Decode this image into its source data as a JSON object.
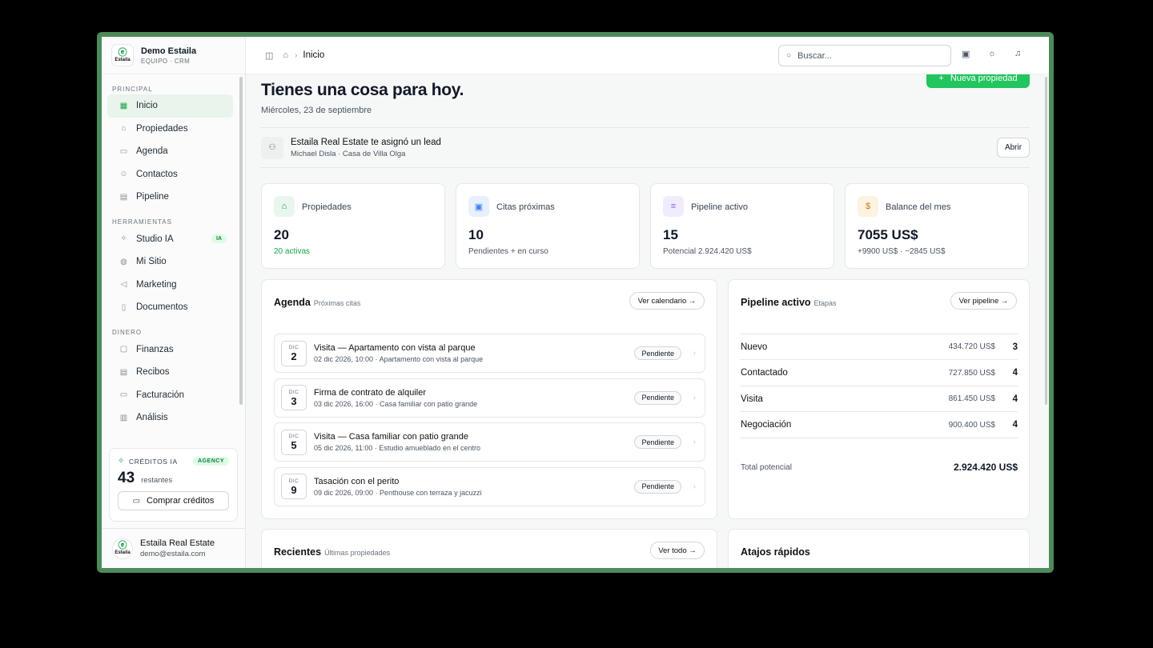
{
  "sidebar": {
    "brand_name": "Demo Estaila",
    "brand_sub": "EQUIPO · CRM",
    "logo_text": "Estaila",
    "sections": {
      "principal": "PRINCIPAL",
      "herramientas": "HERRAMIENTAS",
      "dinero": "DINERO"
    },
    "principal_items": [
      "Inicio",
      "Propiedades",
      "Agenda",
      "Contactos",
      "Pipeline"
    ],
    "herramientas_items": [
      "Studio IA",
      "Mi Sitio",
      "Marketing",
      "Documentos"
    ],
    "studio_badge": "IA",
    "dinero_items": [
      "Finanzas",
      "Recibos",
      "Facturación",
      "Análisis"
    ],
    "active_item": "Inicio",
    "credits": {
      "label": "CRÉDITOS IA",
      "plan": "AGENCY",
      "count": "43",
      "count_label": "restantes",
      "buy_label": "Comprar créditos"
    },
    "user": {
      "name": "Estaila Real Estate",
      "email": "demo@estaila.com"
    }
  },
  "topbar": {
    "breadcrumb": "Inicio",
    "search_placeholder": "Buscar..."
  },
  "main": {
    "greeting": "Tienes una cosa para hoy.",
    "date": "Miércoles, 23 de septiembre",
    "new_property_label": "Nueva propiedad",
    "notification": {
      "title": "Estaila Real Estate te asignó un lead",
      "subtitle": "Michael Disla · Casa de Villa Olga",
      "action": "Abrir"
    },
    "kpis": [
      {
        "label": "Propiedades",
        "value": "20",
        "sub": "20 activas",
        "icon": "home-icon",
        "color": "#16a34a",
        "bg": "#e9f6ee"
      },
      {
        "label": "Citas próximas",
        "value": "10",
        "sub": "Pendientes + en curso",
        "icon": "calendar-icon",
        "color": "#3b82f6",
        "bg": "#e8effd"
      },
      {
        "label": "Pipeline activo",
        "value": "15",
        "sub": "Potencial 2.924.420 US$",
        "icon": "filter-icon",
        "color": "#8b5cf6",
        "bg": "#f1ecfd"
      },
      {
        "label": "Balance del mes",
        "value": "7055 US$",
        "sub": "+9900 US$ · −2845 US$",
        "icon": "dollar-icon",
        "color": "#d97706",
        "bg": "#fdf3e2"
      }
    ],
    "agenda": {
      "title": "Agenda",
      "subtitle": "Próximas citas",
      "action": "Ver calendario →",
      "items": [
        {
          "month": "DIC",
          "day": "2",
          "title": "Visita — Apartamento con vista al parque",
          "detail": "02 dic 2026, 10:00 · Apartamento con vista al parque",
          "status": "Pendiente"
        },
        {
          "month": "DIC",
          "day": "3",
          "title": "Firma de contrato de alquiler",
          "detail": "03 dic 2026, 16:00 · Casa familiar con patio grande",
          "status": "Pendiente"
        },
        {
          "month": "DIC",
          "day": "5",
          "title": "Visita — Casa familiar con patio grande",
          "detail": "05 dic 2026, 11:00 · Estudio amueblado en el centro",
          "status": "Pendiente"
        },
        {
          "month": "DIC",
          "day": "9",
          "title": "Tasación con el perito",
          "detail": "09 dic 2026, 09:00 · Penthouse con terraza y jacuzzi",
          "status": "Pendiente"
        }
      ]
    },
    "pipeline": {
      "title": "Pipeline activo",
      "subtitle": "Etapas",
      "action": "Ver pipeline →",
      "stages": [
        {
          "name": "Nuevo",
          "amount": "434.720 US$",
          "count": "3"
        },
        {
          "name": "Contactado",
          "amount": "727.850 US$",
          "count": "4"
        },
        {
          "name": "Visita",
          "amount": "861.450 US$",
          "count": "4"
        },
        {
          "name": "Negociación",
          "amount": "900.400 US$",
          "count": "4"
        }
      ],
      "total_label": "Total potencial",
      "total_value": "2.924.420 US$"
    },
    "recientes": {
      "title": "Recientes",
      "subtitle": "Últimas propiedades",
      "action": "Ver todo →"
    },
    "atajos": {
      "title": "Atajos rápidos"
    }
  }
}
